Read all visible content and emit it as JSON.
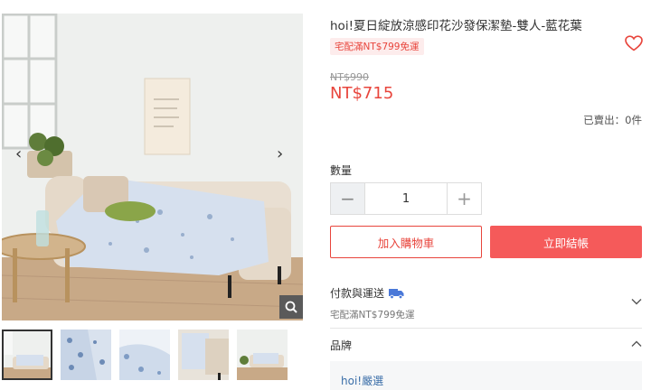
{
  "product": {
    "title": "hoi!夏日綻放涼感印花沙發保潔墊-雙人-藍花葉",
    "shipping_badge": "宅配滿NT$799免運",
    "price_original": "NT$990",
    "price_current": "NT$715",
    "sold": "已賣出：0件"
  },
  "gallery": {
    "prev_glyph": "‹",
    "next_glyph": "›",
    "thumbnail_count": 5,
    "active_thumbnail": 1
  },
  "quantity": {
    "label": "數量",
    "value": "1",
    "minus_glyph": "−",
    "plus_glyph": "+"
  },
  "actions": {
    "add_to_cart": "加入購物車",
    "buy_now": "立即結帳"
  },
  "payment": {
    "title": "付款與運送",
    "subtitle": "宅配滿NT$799免運"
  },
  "brand": {
    "title": "品牌",
    "name": "hoi!嚴選"
  },
  "colors": {
    "accent": "#e8453c",
    "buy_button": "#f55a5a",
    "truck_icon": "#4a78d8",
    "brand_link": "#3a6ea8"
  },
  "icons": [
    "heart-icon",
    "search-icon",
    "truck-icon",
    "chevron-down-icon",
    "chevron-up-icon"
  ]
}
